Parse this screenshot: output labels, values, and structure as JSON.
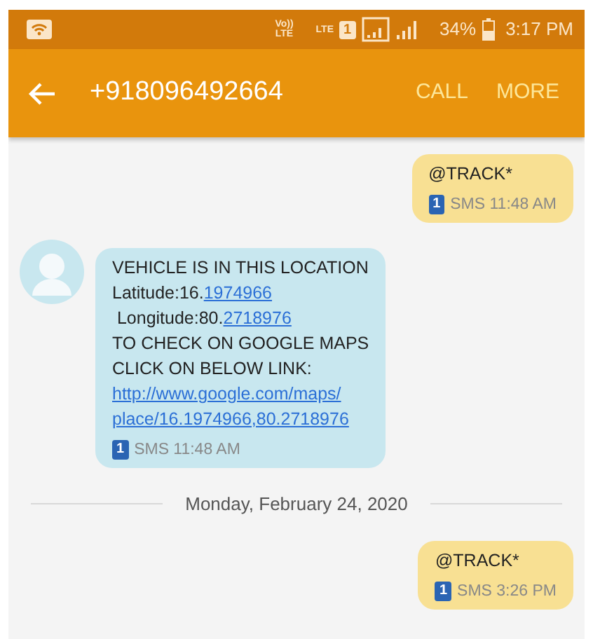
{
  "status_bar": {
    "volte": [
      "Vo))",
      "LTE"
    ],
    "network": "LTE",
    "sim": "1",
    "battery": "34%",
    "time": "3:17 PM"
  },
  "toolbar": {
    "title": "+918096492664",
    "actions": [
      "CALL",
      "MORE"
    ]
  },
  "conversation": [
    {
      "kind": "message",
      "outgoing": true,
      "lines": [
        [
          {
            "text": "@TRACK*",
            "link": false
          }
        ]
      ],
      "sim": "1",
      "meta": "SMS 11:48 AM"
    },
    {
      "kind": "message",
      "outgoing": false,
      "lines": [
        [
          {
            "text": "VEHICLE IS IN THIS LOCATION",
            "link": false
          }
        ],
        [
          {
            "text": "Latitude:16.",
            "link": false
          },
          {
            "text": "1974966",
            "link": true
          }
        ],
        [
          {
            "text": " Longitude:80.",
            "link": false
          },
          {
            "text": "2718976",
            "link": true
          }
        ],
        [
          {
            "text": "TO CHECK ON GOOGLE MAPS",
            "link": false
          }
        ],
        [
          {
            "text": "CLICK ON BELOW LINK:",
            "link": false
          }
        ],
        [
          {
            "text": "http://www.google.com/maps/",
            "link": true
          }
        ],
        [
          {
            "text": "place/16.1974966,80.2718976",
            "link": true
          }
        ]
      ],
      "sim": "1",
      "meta": "SMS 11:48 AM"
    },
    {
      "kind": "date",
      "text": "Monday, February 24, 2020"
    },
    {
      "kind": "message",
      "outgoing": true,
      "lines": [
        [
          {
            "text": "@TRACK*",
            "link": false
          }
        ]
      ],
      "sim": "1",
      "meta": "SMS 3:26 PM"
    }
  ]
}
